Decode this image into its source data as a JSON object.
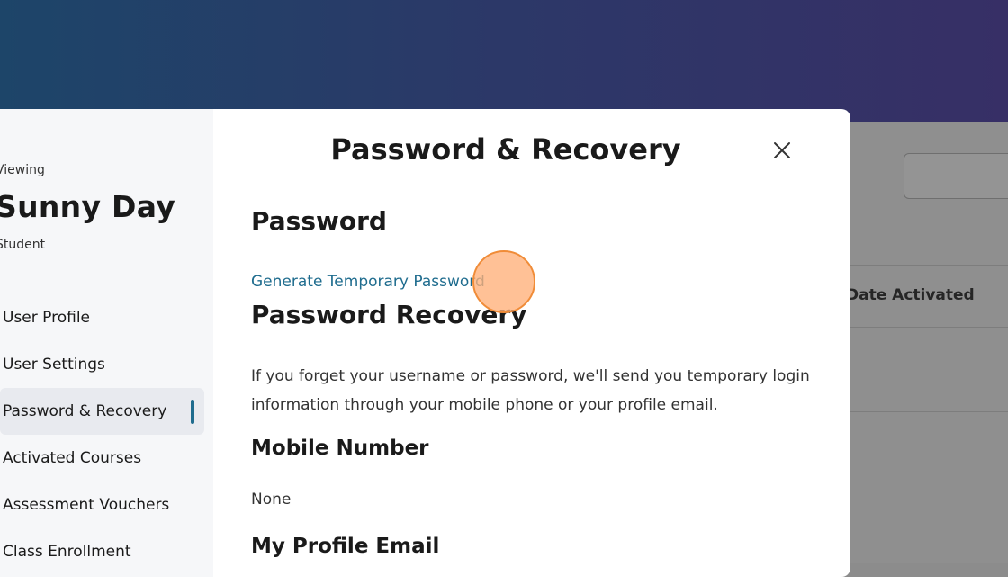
{
  "background": {
    "column_header": "Date Activated"
  },
  "modal": {
    "title": "Password & Recovery",
    "close_icon": "close-icon"
  },
  "sidebar": {
    "viewing_label": "Viewing",
    "user_name": "Sunny Day",
    "user_role": "Student",
    "items": [
      {
        "label": "User Profile"
      },
      {
        "label": "User Settings"
      },
      {
        "label": "Password & Recovery",
        "active": true
      },
      {
        "label": "Activated Courses"
      },
      {
        "label": "Assessment Vouchers"
      },
      {
        "label": "Class Enrollment"
      }
    ]
  },
  "content": {
    "password_heading": "Password",
    "generate_link": "Generate Temporary Password",
    "recovery_heading": "Password Recovery",
    "recovery_description": "If you forget your username or password, we'll send you temporary login information through your mobile phone or your profile email.",
    "mobile_heading": "Mobile Number",
    "mobile_value": "None",
    "email_heading": "My Profile Email"
  },
  "colors": {
    "accent": "#1f6c8e",
    "header_gradient_start": "#1d4569",
    "header_gradient_end": "#372f66"
  }
}
